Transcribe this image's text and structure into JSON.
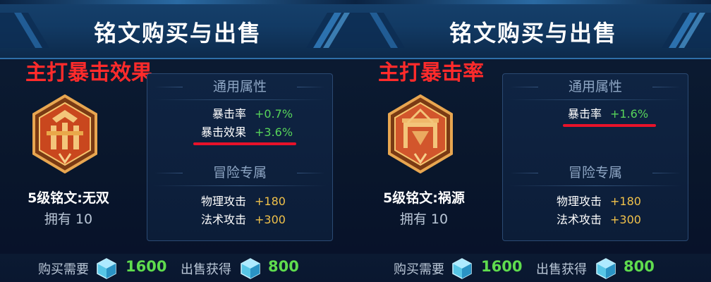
{
  "panels": [
    {
      "header_title": "铭文购买与出售",
      "highlight": "主打暴击效果",
      "rune": {
        "name": "5级铭文:无双",
        "owned": "拥有 10",
        "emblem_icon": "wushuang-rune-icon"
      },
      "general_title": "通用属性",
      "general_stats": [
        {
          "label": "暴击率",
          "value": "+0.7%"
        },
        {
          "label": "暴击效果",
          "value": "+3.6%"
        }
      ],
      "adventure_title": "冒险专属",
      "adventure_stats": [
        {
          "label": "物理攻击",
          "value": "+180"
        },
        {
          "label": "法术攻击",
          "value": "+300"
        }
      ],
      "footer": {
        "buy_label": "购买需要",
        "buy_price": "1600",
        "sell_label": "出售获得",
        "sell_price": "800",
        "currency_icon": "diamond-icon"
      }
    },
    {
      "header_title": "铭文购买与出售",
      "highlight": "主打暴击率",
      "rune": {
        "name": "5级铭文:祸源",
        "owned": "拥有 10",
        "emblem_icon": "huoyuan-rune-icon"
      },
      "general_title": "通用属性",
      "general_stats": [
        {
          "label": "暴击率",
          "value": "+1.6%"
        }
      ],
      "adventure_title": "冒险专属",
      "adventure_stats": [
        {
          "label": "物理攻击",
          "value": "+180"
        },
        {
          "label": "法术攻击",
          "value": "+300"
        }
      ],
      "footer": {
        "buy_label": "购买需要",
        "buy_price": "1600",
        "sell_label": "出售获得",
        "sell_price": "800",
        "currency_icon": "diamond-icon"
      }
    }
  ],
  "colors": {
    "highlight": "#ff2b2b",
    "positive_green": "#57d45a",
    "gold_value": "#f0c14a",
    "underline_red": "#e8122a"
  }
}
